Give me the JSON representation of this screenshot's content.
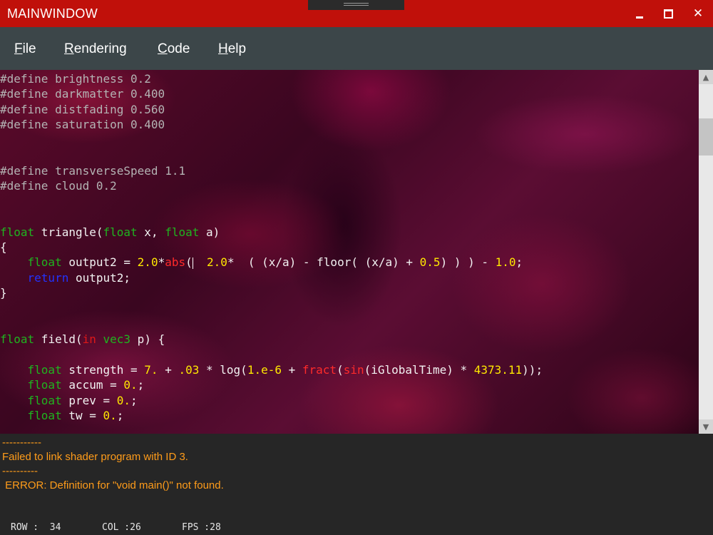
{
  "window": {
    "title": "MAINWINDOW",
    "minimize_icon": "minimize-icon",
    "maximize_icon": "maximize-icon",
    "close_icon": "close-icon",
    "close_glyph": "✕"
  },
  "menu": {
    "items": [
      {
        "label": "File",
        "mnemonic": "F"
      },
      {
        "label": "Rendering",
        "mnemonic": "R"
      },
      {
        "label": "Code",
        "mnemonic": "C"
      },
      {
        "label": "Help",
        "mnemonic": "H"
      }
    ]
  },
  "editor": {
    "lines": [
      [
        {
          "t": "#define brightness 0.2",
          "c": "def"
        }
      ],
      [
        {
          "t": "#define darkmatter 0.400",
          "c": "def"
        }
      ],
      [
        {
          "t": "#define distfading 0.560",
          "c": "def"
        }
      ],
      [
        {
          "t": "#define saturation 0.400",
          "c": "def"
        }
      ],
      [
        {
          "t": "#define transverseSpeed 1.1",
          "c": "def"
        }
      ],
      [
        {
          "t": "#define cloud 0.2",
          "c": "def"
        }
      ],
      [
        {
          "t": "float",
          "c": "kw"
        },
        {
          "t": " triangle(",
          "c": "txt"
        },
        {
          "t": "float",
          "c": "kw"
        },
        {
          "t": " x, ",
          "c": "txt"
        },
        {
          "t": "float",
          "c": "kw"
        },
        {
          "t": " a)",
          "c": "txt"
        }
      ],
      [
        {
          "t": "{",
          "c": "txt"
        }
      ],
      [
        {
          "t": "    ",
          "c": "txt"
        },
        {
          "t": "float",
          "c": "kw"
        },
        {
          "t": " output2 = ",
          "c": "txt"
        },
        {
          "t": "2.0",
          "c": "num"
        },
        {
          "t": "*",
          "c": "txt"
        },
        {
          "t": "abs",
          "c": "fn"
        },
        {
          "t": "(",
          "c": "txt"
        },
        {
          "t": "|",
          "c": "cursor"
        },
        {
          "t": "  ",
          "c": "txt"
        },
        {
          "t": "2.0",
          "c": "num"
        },
        {
          "t": "*  ( (x/a) - floor( (x/a) + ",
          "c": "txt"
        },
        {
          "t": "0.5",
          "c": "num"
        },
        {
          "t": ") ) ) - ",
          "c": "txt"
        },
        {
          "t": "1.0",
          "c": "num"
        },
        {
          "t": ";",
          "c": "txt"
        }
      ],
      [
        {
          "t": "    ",
          "c": "txt"
        },
        {
          "t": "return",
          "c": "ret"
        },
        {
          "t": " output2;",
          "c": "txt"
        }
      ],
      [
        {
          "t": "}",
          "c": "txt"
        }
      ],
      [
        {
          "t": "float",
          "c": "kw"
        },
        {
          "t": " field(",
          "c": "txt"
        },
        {
          "t": "in",
          "c": "in"
        },
        {
          "t": " ",
          "c": "txt"
        },
        {
          "t": "vec3",
          "c": "kw"
        },
        {
          "t": " p) {",
          "c": "txt"
        }
      ],
      [
        {
          "t": "    ",
          "c": "txt"
        },
        {
          "t": "float",
          "c": "kw"
        },
        {
          "t": " strength = ",
          "c": "txt"
        },
        {
          "t": "7.",
          "c": "num"
        },
        {
          "t": " + ",
          "c": "txt"
        },
        {
          "t": ".03",
          "c": "num"
        },
        {
          "t": " * log(",
          "c": "txt"
        },
        {
          "t": "1.e-6",
          "c": "num"
        },
        {
          "t": " + ",
          "c": "txt"
        },
        {
          "t": "fract",
          "c": "fn"
        },
        {
          "t": "(",
          "c": "txt"
        },
        {
          "t": "sin",
          "c": "fn"
        },
        {
          "t": "(iGlobalTime) * ",
          "c": "txt"
        },
        {
          "t": "4373.11",
          "c": "num"
        },
        {
          "t": "));",
          "c": "txt"
        }
      ],
      [
        {
          "t": "    ",
          "c": "txt"
        },
        {
          "t": "float",
          "c": "kw"
        },
        {
          "t": " accum = ",
          "c": "txt"
        },
        {
          "t": "0.",
          "c": "num"
        },
        {
          "t": ";",
          "c": "txt"
        }
      ],
      [
        {
          "t": "    ",
          "c": "txt"
        },
        {
          "t": "float",
          "c": "kw"
        },
        {
          "t": " prev = ",
          "c": "txt"
        },
        {
          "t": "0.",
          "c": "num"
        },
        {
          "t": ";",
          "c": "txt"
        }
      ],
      [
        {
          "t": "    ",
          "c": "txt"
        },
        {
          "t": "float",
          "c": "kw"
        },
        {
          "t": " tw = ",
          "c": "txt"
        },
        {
          "t": "0.",
          "c": "num"
        },
        {
          "t": ";",
          "c": "txt"
        }
      ]
    ],
    "colors": {
      "define": "#b4b4b4",
      "keyword": "#1fb41f",
      "return": "#2233ff",
      "in": "#e01818",
      "function": "#ff2a2a",
      "number": "#ffe800",
      "text": "#f2f2f2"
    }
  },
  "scrollbar": {
    "up_icon": "scroll-up-arrow-icon",
    "down_icon": "scroll-down-arrow-icon",
    "up_glyph": "▲",
    "down_glyph": "▼"
  },
  "output": {
    "lines": [
      "-----------",
      "Failed to link shader program with ID 3.",
      "----------",
      " ERROR: Definition for \"void main()\" not found."
    ],
    "color": "#ff9c1a"
  },
  "status": {
    "row": "ROW :  34",
    "col": "COL :26",
    "fps": "FPS :28"
  },
  "theme": {
    "titlebar": "#c0100a",
    "menubar": "#3c4649",
    "output_bg": "#262626"
  }
}
